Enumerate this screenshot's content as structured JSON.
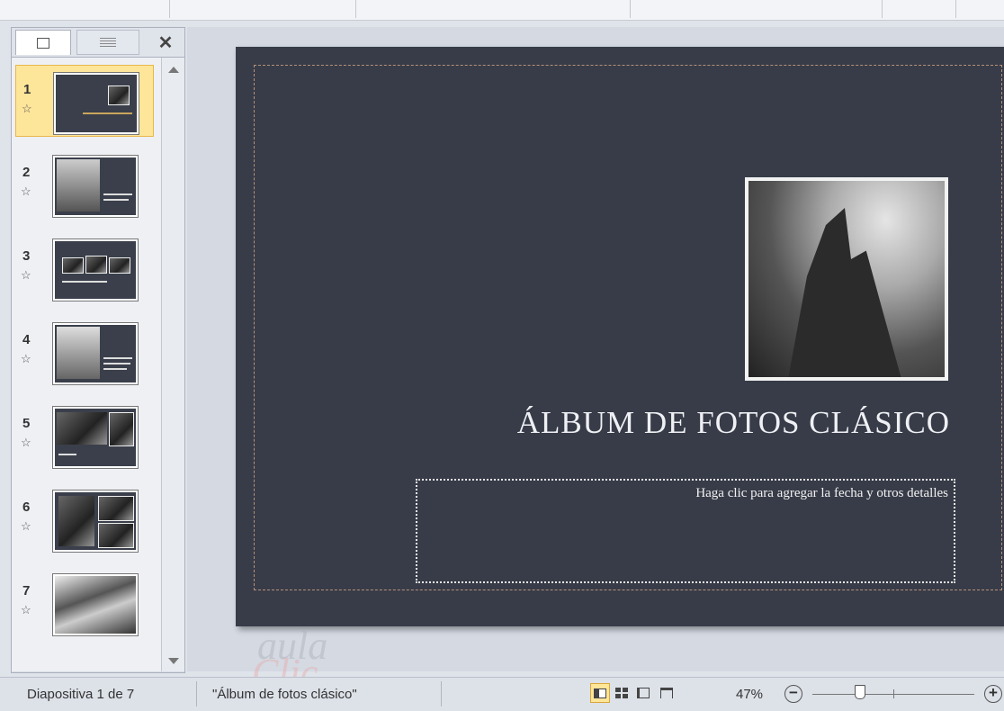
{
  "slide_panel": {
    "tabs": {
      "slides_icon": "slides-icon",
      "outline_icon": "outline-icon",
      "close_icon": "close-icon",
      "close_glyph": "✕"
    },
    "slides": [
      {
        "number": "1",
        "selected": true
      },
      {
        "number": "2",
        "selected": false
      },
      {
        "number": "3",
        "selected": false
      },
      {
        "number": "4",
        "selected": false
      },
      {
        "number": "5",
        "selected": false
      },
      {
        "number": "6",
        "selected": false
      },
      {
        "number": "7",
        "selected": false
      }
    ],
    "transition_glyph": "☆"
  },
  "slide": {
    "title": "ÁLBUM DE FOTOS CLÁSICO",
    "subtitle_placeholder": "Haga clic para  agregar la fecha y otros detalles",
    "background_color": "#383c48"
  },
  "watermark": {
    "line1": "aula",
    "line2": "Clic"
  },
  "status_bar": {
    "slide_counter": "Diapositiva 1 de 7",
    "theme_name": "\"Álbum de fotos clásico\"",
    "zoom": "47%",
    "zoom_out": "−",
    "zoom_in": "+",
    "views": [
      "normal-view-icon",
      "slide-sorter-icon",
      "reading-view-icon",
      "slide-show-icon"
    ],
    "active_view": "normal-view-icon"
  },
  "colors": {
    "selected_thumb": "#fde59a",
    "selected_border": "#e9b84a"
  }
}
